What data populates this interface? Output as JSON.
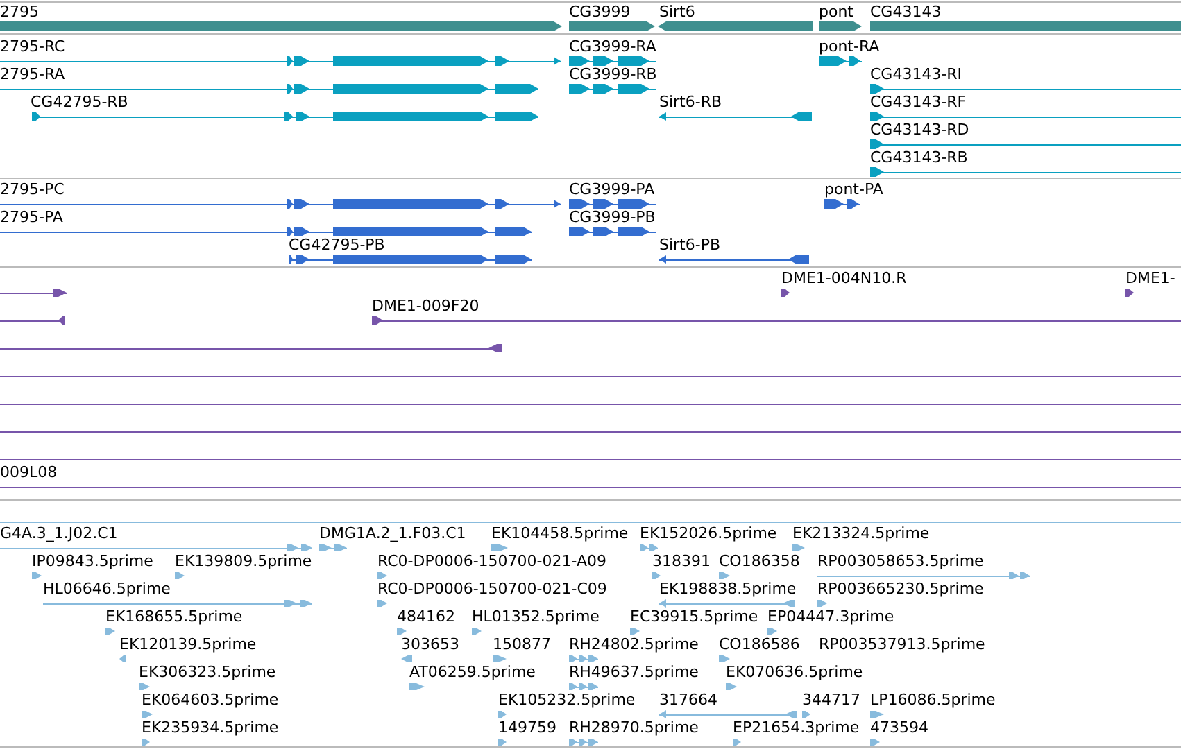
{
  "tracks": [
    {
      "kind": "gene",
      "color": "#3f8f8f",
      "features": [
        {
          "label": "2795",
          "reverse": false
        },
        {
          "label": "CG3999",
          "reverse": false
        },
        {
          "label": "Sirt6",
          "reverse": true
        },
        {
          "label": "pont",
          "reverse": false
        },
        {
          "label": "CG43143",
          "reverse": false
        }
      ]
    },
    {
      "kind": "transcript",
      "color": "#0aa0c0",
      "features": [
        {
          "label": "2795-RC",
          "reverse": false
        },
        {
          "label": "CG3999-RA",
          "reverse": false
        },
        {
          "label": "pont-RA",
          "reverse": false
        },
        {
          "label": "2795-RA",
          "reverse": false
        },
        {
          "label": "CG3999-RB",
          "reverse": false
        },
        {
          "label": "CG43143-RI",
          "reverse": false
        },
        {
          "label": "CG42795-RB",
          "reverse": false
        },
        {
          "label": "Sirt6-RB",
          "reverse": true
        },
        {
          "label": "CG43143-RF",
          "reverse": false
        },
        {
          "label": "CG43143-RD",
          "reverse": false
        },
        {
          "label": "CG43143-RB",
          "reverse": false
        }
      ]
    },
    {
      "kind": "protein",
      "color": "#336dd0",
      "features": [
        {
          "label": "2795-PC",
          "reverse": false
        },
        {
          "label": "CG3999-PA",
          "reverse": false
        },
        {
          "label": "pont-PA",
          "reverse": false
        },
        {
          "label": "2795-PA",
          "reverse": false
        },
        {
          "label": "CG3999-PB",
          "reverse": false
        },
        {
          "label": "CG42795-PB",
          "reverse": false
        },
        {
          "label": "Sirt6-PB",
          "reverse": true
        }
      ]
    },
    {
      "kind": "clone",
      "color": "#7755aa",
      "features": [
        {
          "kind": "end",
          "reverse": false
        },
        {
          "kind": "end",
          "label": "DME1-004N10.R",
          "reverse": false
        },
        {
          "kind": "end",
          "label": "DME1-",
          "reverse": false
        },
        {
          "kind": "end",
          "reverse": true
        },
        {
          "kind": "end",
          "label": "DME1-009F20",
          "reverse": false
        },
        {
          "kind": "end",
          "reverse": true
        },
        {
          "kind": "span"
        },
        {
          "kind": "span"
        },
        {
          "kind": "span"
        },
        {
          "kind": "span"
        },
        {
          "kind": "span",
          "label": "009L08"
        }
      ]
    },
    {
      "kind": "est",
      "color": "#88bbdd",
      "features": [
        {
          "label": "G4A.3_1.J02.C1",
          "reverse": false
        },
        {
          "label": "DMG1A.2_1.F03.C1",
          "reverse": false
        },
        {
          "label": "EK104458.5prime",
          "reverse": false
        },
        {
          "label": "EK152026.5prime",
          "reverse": false
        },
        {
          "label": "EK213324.5prime",
          "reverse": false
        },
        {
          "label": "IP09843.5prime",
          "reverse": false
        },
        {
          "label": "EK139809.5prime",
          "reverse": false
        },
        {
          "label": "RC0-DP0006-150700-021-A09",
          "reverse": false
        },
        {
          "label": "318391",
          "reverse": false
        },
        {
          "label": "CO186358",
          "reverse": false
        },
        {
          "label": "RP003058653.5prime",
          "reverse": false
        },
        {
          "label": "HL06646.5prime",
          "reverse": false
        },
        {
          "label": "RC0-DP0006-150700-021-C09",
          "reverse": false
        },
        {
          "label": "EK198838.5prime",
          "reverse": true
        },
        {
          "label": "RP003665230.5prime",
          "reverse": false
        },
        {
          "label": "EK168655.5prime",
          "reverse": false
        },
        {
          "label": "484162",
          "reverse": false
        },
        {
          "label": "HL01352.5prime",
          "reverse": false
        },
        {
          "label": "EC39915.5prime",
          "reverse": false
        },
        {
          "label": "EP04447.3prime",
          "reverse": false
        },
        {
          "label": "EK120139.5prime",
          "reverse": true
        },
        {
          "label": "303653",
          "reverse": true
        },
        {
          "label": "150877",
          "reverse": false
        },
        {
          "label": "RH24802.5prime",
          "reverse": false
        },
        {
          "label": "CO186586",
          "reverse": false
        },
        {
          "label": "RP003537913.5prime"
        },
        {
          "label": "EK306323.5prime",
          "reverse": false
        },
        {
          "label": "AT06259.5prime",
          "reverse": false
        },
        {
          "label": "RH49637.5prime",
          "reverse": false
        },
        {
          "label": "EK070636.5prime",
          "reverse": false
        },
        {
          "label": "EK064603.5prime",
          "reverse": false
        },
        {
          "label": "EK105232.5prime",
          "reverse": false
        },
        {
          "label": "317664",
          "reverse": true
        },
        {
          "label": "344717",
          "reverse": false
        },
        {
          "label": "LP16086.5prime",
          "reverse": false
        },
        {
          "label": "EK235934.5prime",
          "reverse": false
        },
        {
          "label": "149759",
          "reverse": false
        },
        {
          "label": "RH28970.5prime",
          "reverse": false
        },
        {
          "label": "EP21654.3prime",
          "reverse": false
        },
        {
          "label": "473594",
          "reverse": false
        }
      ]
    }
  ]
}
